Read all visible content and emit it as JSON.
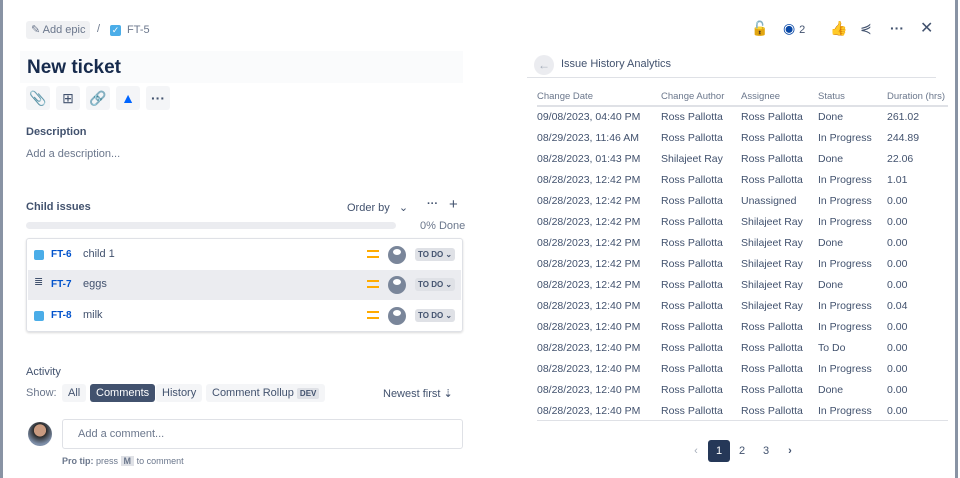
{
  "breadcrumb": {
    "epic": "Add epic",
    "separator": "/",
    "issue_key": "FT-5"
  },
  "title": "New ticket",
  "toolbar": [
    "attach",
    "child-issue",
    "link",
    "atlassian",
    "more"
  ],
  "description": {
    "label": "Description",
    "placeholder": "Add a description..."
  },
  "child_issues": {
    "label": "Child issues",
    "order_by": "Order by",
    "progress_text": "0% Done",
    "progress": 0,
    "items": [
      {
        "key": "FT-6",
        "summary": "child 1",
        "status": "TO DO"
      },
      {
        "key": "FT-7",
        "summary": "eggs",
        "status": "TO DO"
      },
      {
        "key": "FT-8",
        "summary": "milk",
        "status": "TO DO"
      }
    ]
  },
  "activity": {
    "label": "Activity",
    "show": "Show:",
    "filters": [
      "All",
      "Comments",
      "History",
      "Comment Rollup"
    ],
    "dev_badge": "DEV",
    "sort": "Newest first",
    "comment_placeholder": "Add a comment...",
    "pro_tip": "Pro tip:",
    "press": "press",
    "key": "M",
    "to_comment": "to comment"
  },
  "header": {
    "watch_count": "2"
  },
  "panel": {
    "title": "Issue History Analytics",
    "columns": [
      "Change Date",
      "Change Author",
      "Assignee",
      "Status",
      "Duration (hrs)"
    ],
    "rows": [
      [
        "09/08/2023, 04:40 PM",
        "Ross Pallotta",
        "Ross Pallotta",
        "Done",
        "261.02"
      ],
      [
        "08/29/2023, 11:46 AM",
        "Ross Pallotta",
        "Ross Pallotta",
        "In Progress",
        "244.89"
      ],
      [
        "08/28/2023, 01:43 PM",
        "Shilajeet Ray",
        "Ross Pallotta",
        "Done",
        "22.06"
      ],
      [
        "08/28/2023, 12:42 PM",
        "Ross Pallotta",
        "Ross Pallotta",
        "In Progress",
        "1.01"
      ],
      [
        "08/28/2023, 12:42 PM",
        "Ross Pallotta",
        "Unassigned",
        "In Progress",
        "0.00"
      ],
      [
        "08/28/2023, 12:42 PM",
        "Ross Pallotta",
        "Shilajeet Ray",
        "In Progress",
        "0.00"
      ],
      [
        "08/28/2023, 12:42 PM",
        "Ross Pallotta",
        "Shilajeet Ray",
        "Done",
        "0.00"
      ],
      [
        "08/28/2023, 12:42 PM",
        "Ross Pallotta",
        "Shilajeet Ray",
        "In Progress",
        "0.00"
      ],
      [
        "08/28/2023, 12:42 PM",
        "Ross Pallotta",
        "Shilajeet Ray",
        "Done",
        "0.00"
      ],
      [
        "08/28/2023, 12:40 PM",
        "Ross Pallotta",
        "Shilajeet Ray",
        "In Progress",
        "0.04"
      ],
      [
        "08/28/2023, 12:40 PM",
        "Ross Pallotta",
        "Ross Pallotta",
        "In Progress",
        "0.00"
      ],
      [
        "08/28/2023, 12:40 PM",
        "Ross Pallotta",
        "Ross Pallotta",
        "To Do",
        "0.00"
      ],
      [
        "08/28/2023, 12:40 PM",
        "Ross Pallotta",
        "Ross Pallotta",
        "In Progress",
        "0.00"
      ],
      [
        "08/28/2023, 12:40 PM",
        "Ross Pallotta",
        "Ross Pallotta",
        "Done",
        "0.00"
      ],
      [
        "08/28/2023, 12:40 PM",
        "Ross Pallotta",
        "Ross Pallotta",
        "In Progress",
        "0.00"
      ]
    ],
    "pages": [
      "1",
      "2",
      "3"
    ],
    "current_page": "1"
  }
}
